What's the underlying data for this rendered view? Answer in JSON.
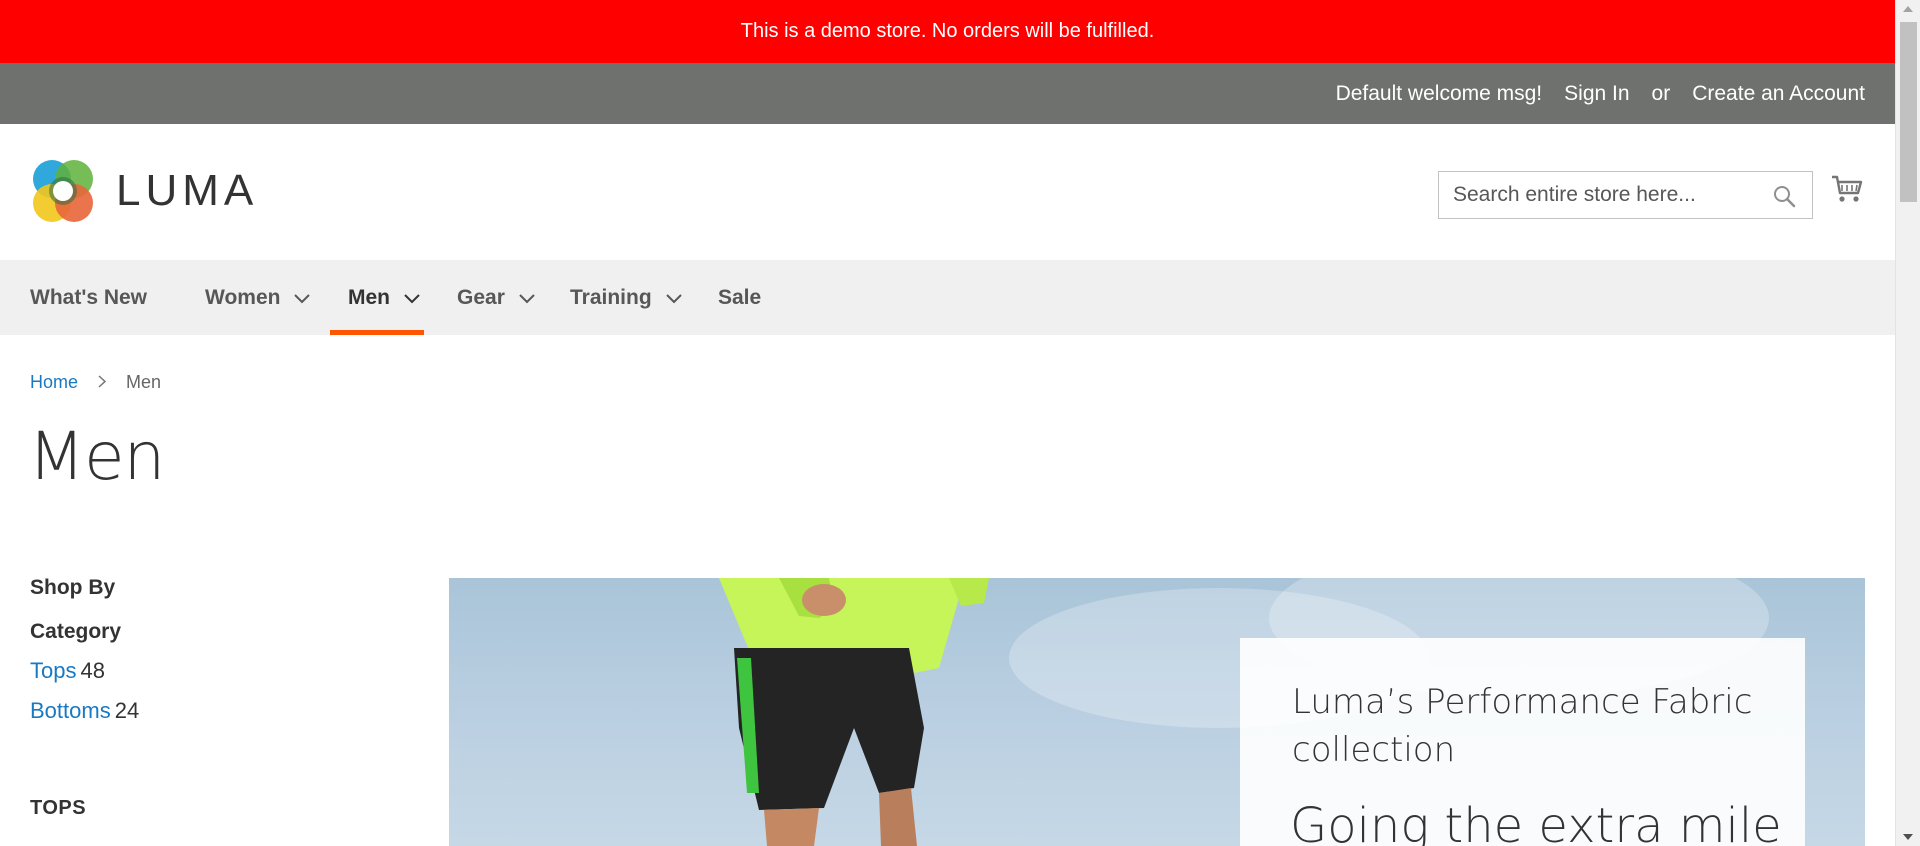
{
  "notice": {
    "text": "This is a demo store. No orders will be fulfilled."
  },
  "top_panel": {
    "welcome": "Default welcome msg!",
    "sign_in": "Sign In",
    "or": "or",
    "create_account": "Create an Account"
  },
  "header": {
    "logo_text": "LUMA",
    "search_placeholder": "Search entire store here...",
    "search_icon": "search-icon",
    "cart_icon": "cart-icon"
  },
  "nav": {
    "items": [
      {
        "label": "What's New",
        "has_dropdown": false,
        "active": false
      },
      {
        "label": "Women",
        "has_dropdown": true,
        "active": false
      },
      {
        "label": "Men",
        "has_dropdown": true,
        "active": true
      },
      {
        "label": "Gear",
        "has_dropdown": true,
        "active": false
      },
      {
        "label": "Training",
        "has_dropdown": true,
        "active": false
      },
      {
        "label": "Sale",
        "has_dropdown": false,
        "active": false
      }
    ],
    "active_color": "#ff5501"
  },
  "breadcrumb": {
    "home": "Home",
    "current": "Men"
  },
  "page_title": "Men",
  "sidebar": {
    "shop_by": "Shop By",
    "filter_title": "Category",
    "filters": [
      {
        "label": "Tops",
        "count": "48"
      },
      {
        "label": "Bottoms",
        "count": "24"
      }
    ],
    "section_heading": "TOPS"
  },
  "hero": {
    "subtitle": "Luma’s Performance Fabric collection",
    "headline": "Going the extra mile"
  },
  "colors": {
    "notice_bg": "#ff0000",
    "top_panel_bg": "#6e716e",
    "nav_bg": "#f0f0f0",
    "link": "#1979c3"
  }
}
